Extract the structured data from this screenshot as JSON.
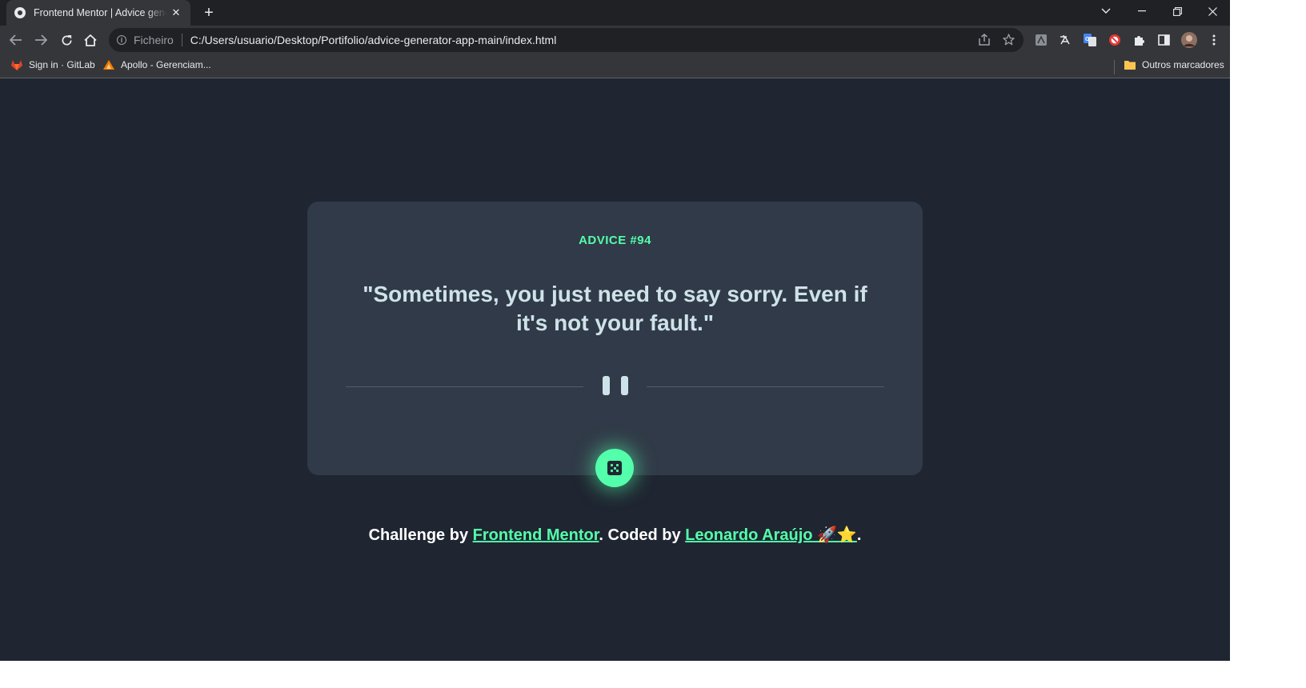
{
  "browser": {
    "tab": {
      "title": "Frontend Mentor | Advice generator app"
    },
    "address": {
      "scheme_label": "Ficheiro",
      "url": "C:/Users/usuario/Desktop/Portifolio/advice-generator-app-main/index.html"
    },
    "bookmarks": [
      {
        "label": "Sign in · GitLab",
        "icon": "gitlab-icon"
      },
      {
        "label": "Apollo - Gerenciam...",
        "icon": "apollo-icon"
      }
    ],
    "other_bookmarks": "Outros marcadores"
  },
  "card": {
    "advice_id": "ADVICE #94",
    "advice_text": "\"Sometimes, you just need to say sorry. Even if it's not your fault.\""
  },
  "footer": {
    "challenge_prefix": "Challenge by",
    "frontend_mentor_link": "Frontend Mentor",
    "coded_by": ". Coded by",
    "author_link": "Leonardo Araújo 🚀⭐",
    "suffix": "."
  },
  "colors": {
    "page_bg": "#1f2531",
    "card_bg": "#313a48",
    "accent": "#53ffaa",
    "text": "#cee3e9"
  }
}
